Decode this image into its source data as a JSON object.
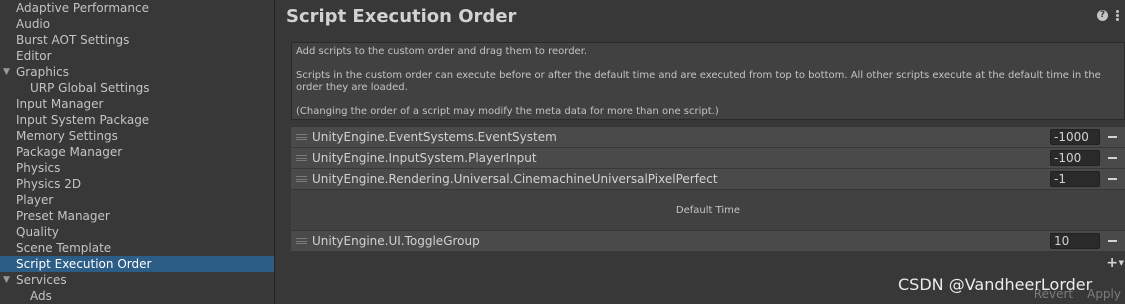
{
  "sidebar": {
    "items": [
      {
        "label": "Adaptive Performance",
        "child": false,
        "expandable": false,
        "selected": false
      },
      {
        "label": "Audio",
        "child": false,
        "expandable": false,
        "selected": false
      },
      {
        "label": "Burst AOT Settings",
        "child": false,
        "expandable": false,
        "selected": false
      },
      {
        "label": "Editor",
        "child": false,
        "expandable": false,
        "selected": false
      },
      {
        "label": "Graphics",
        "child": false,
        "expandable": true,
        "selected": false
      },
      {
        "label": "URP Global Settings",
        "child": true,
        "expandable": false,
        "selected": false
      },
      {
        "label": "Input Manager",
        "child": false,
        "expandable": false,
        "selected": false
      },
      {
        "label": "Input System Package",
        "child": false,
        "expandable": false,
        "selected": false
      },
      {
        "label": "Memory Settings",
        "child": false,
        "expandable": false,
        "selected": false
      },
      {
        "label": "Package Manager",
        "child": false,
        "expandable": false,
        "selected": false
      },
      {
        "label": "Physics",
        "child": false,
        "expandable": false,
        "selected": false
      },
      {
        "label": "Physics 2D",
        "child": false,
        "expandable": false,
        "selected": false
      },
      {
        "label": "Player",
        "child": false,
        "expandable": false,
        "selected": false
      },
      {
        "label": "Preset Manager",
        "child": false,
        "expandable": false,
        "selected": false
      },
      {
        "label": "Quality",
        "child": false,
        "expandable": false,
        "selected": false
      },
      {
        "label": "Scene Template",
        "child": false,
        "expandable": false,
        "selected": false
      },
      {
        "label": "Script Execution Order",
        "child": false,
        "expandable": false,
        "selected": true
      },
      {
        "label": "Services",
        "child": false,
        "expandable": true,
        "selected": false
      },
      {
        "label": "Ads",
        "child": true,
        "expandable": false,
        "selected": false
      }
    ]
  },
  "main": {
    "title": "Script Execution Order",
    "info": {
      "line1": "Add scripts to the custom order and drag them to reorder.",
      "line2": "Scripts in the custom order can execute before or after the default time and are executed from top to bottom. All other scripts execute at the default time in the order they are loaded.",
      "line3": "(Changing the order of a script may modify the meta data for more than one script.)"
    },
    "scripts_before": [
      {
        "name": "UnityEngine.EventSystems.EventSystem",
        "order": "-1000"
      },
      {
        "name": "UnityEngine.InputSystem.PlayerInput",
        "order": "-100"
      },
      {
        "name": "UnityEngine.Rendering.Universal.CinemachineUniversalPixelPerfect",
        "order": "-1"
      }
    ],
    "default_time_label": "Default Time",
    "scripts_after": [
      {
        "name": "UnityEngine.UI.ToggleGroup",
        "order": "10"
      }
    ],
    "add_label": "+",
    "add_arrow": "▼",
    "revert_label": "Revert",
    "apply_label": "Apply"
  },
  "icons": {
    "help": "?",
    "expand_arrow": "▼"
  },
  "watermark": "CSDN @VandheerLorder",
  "colors": {
    "selected": "#2c5d87",
    "background": "#383838",
    "row": "#4a4a4a"
  }
}
